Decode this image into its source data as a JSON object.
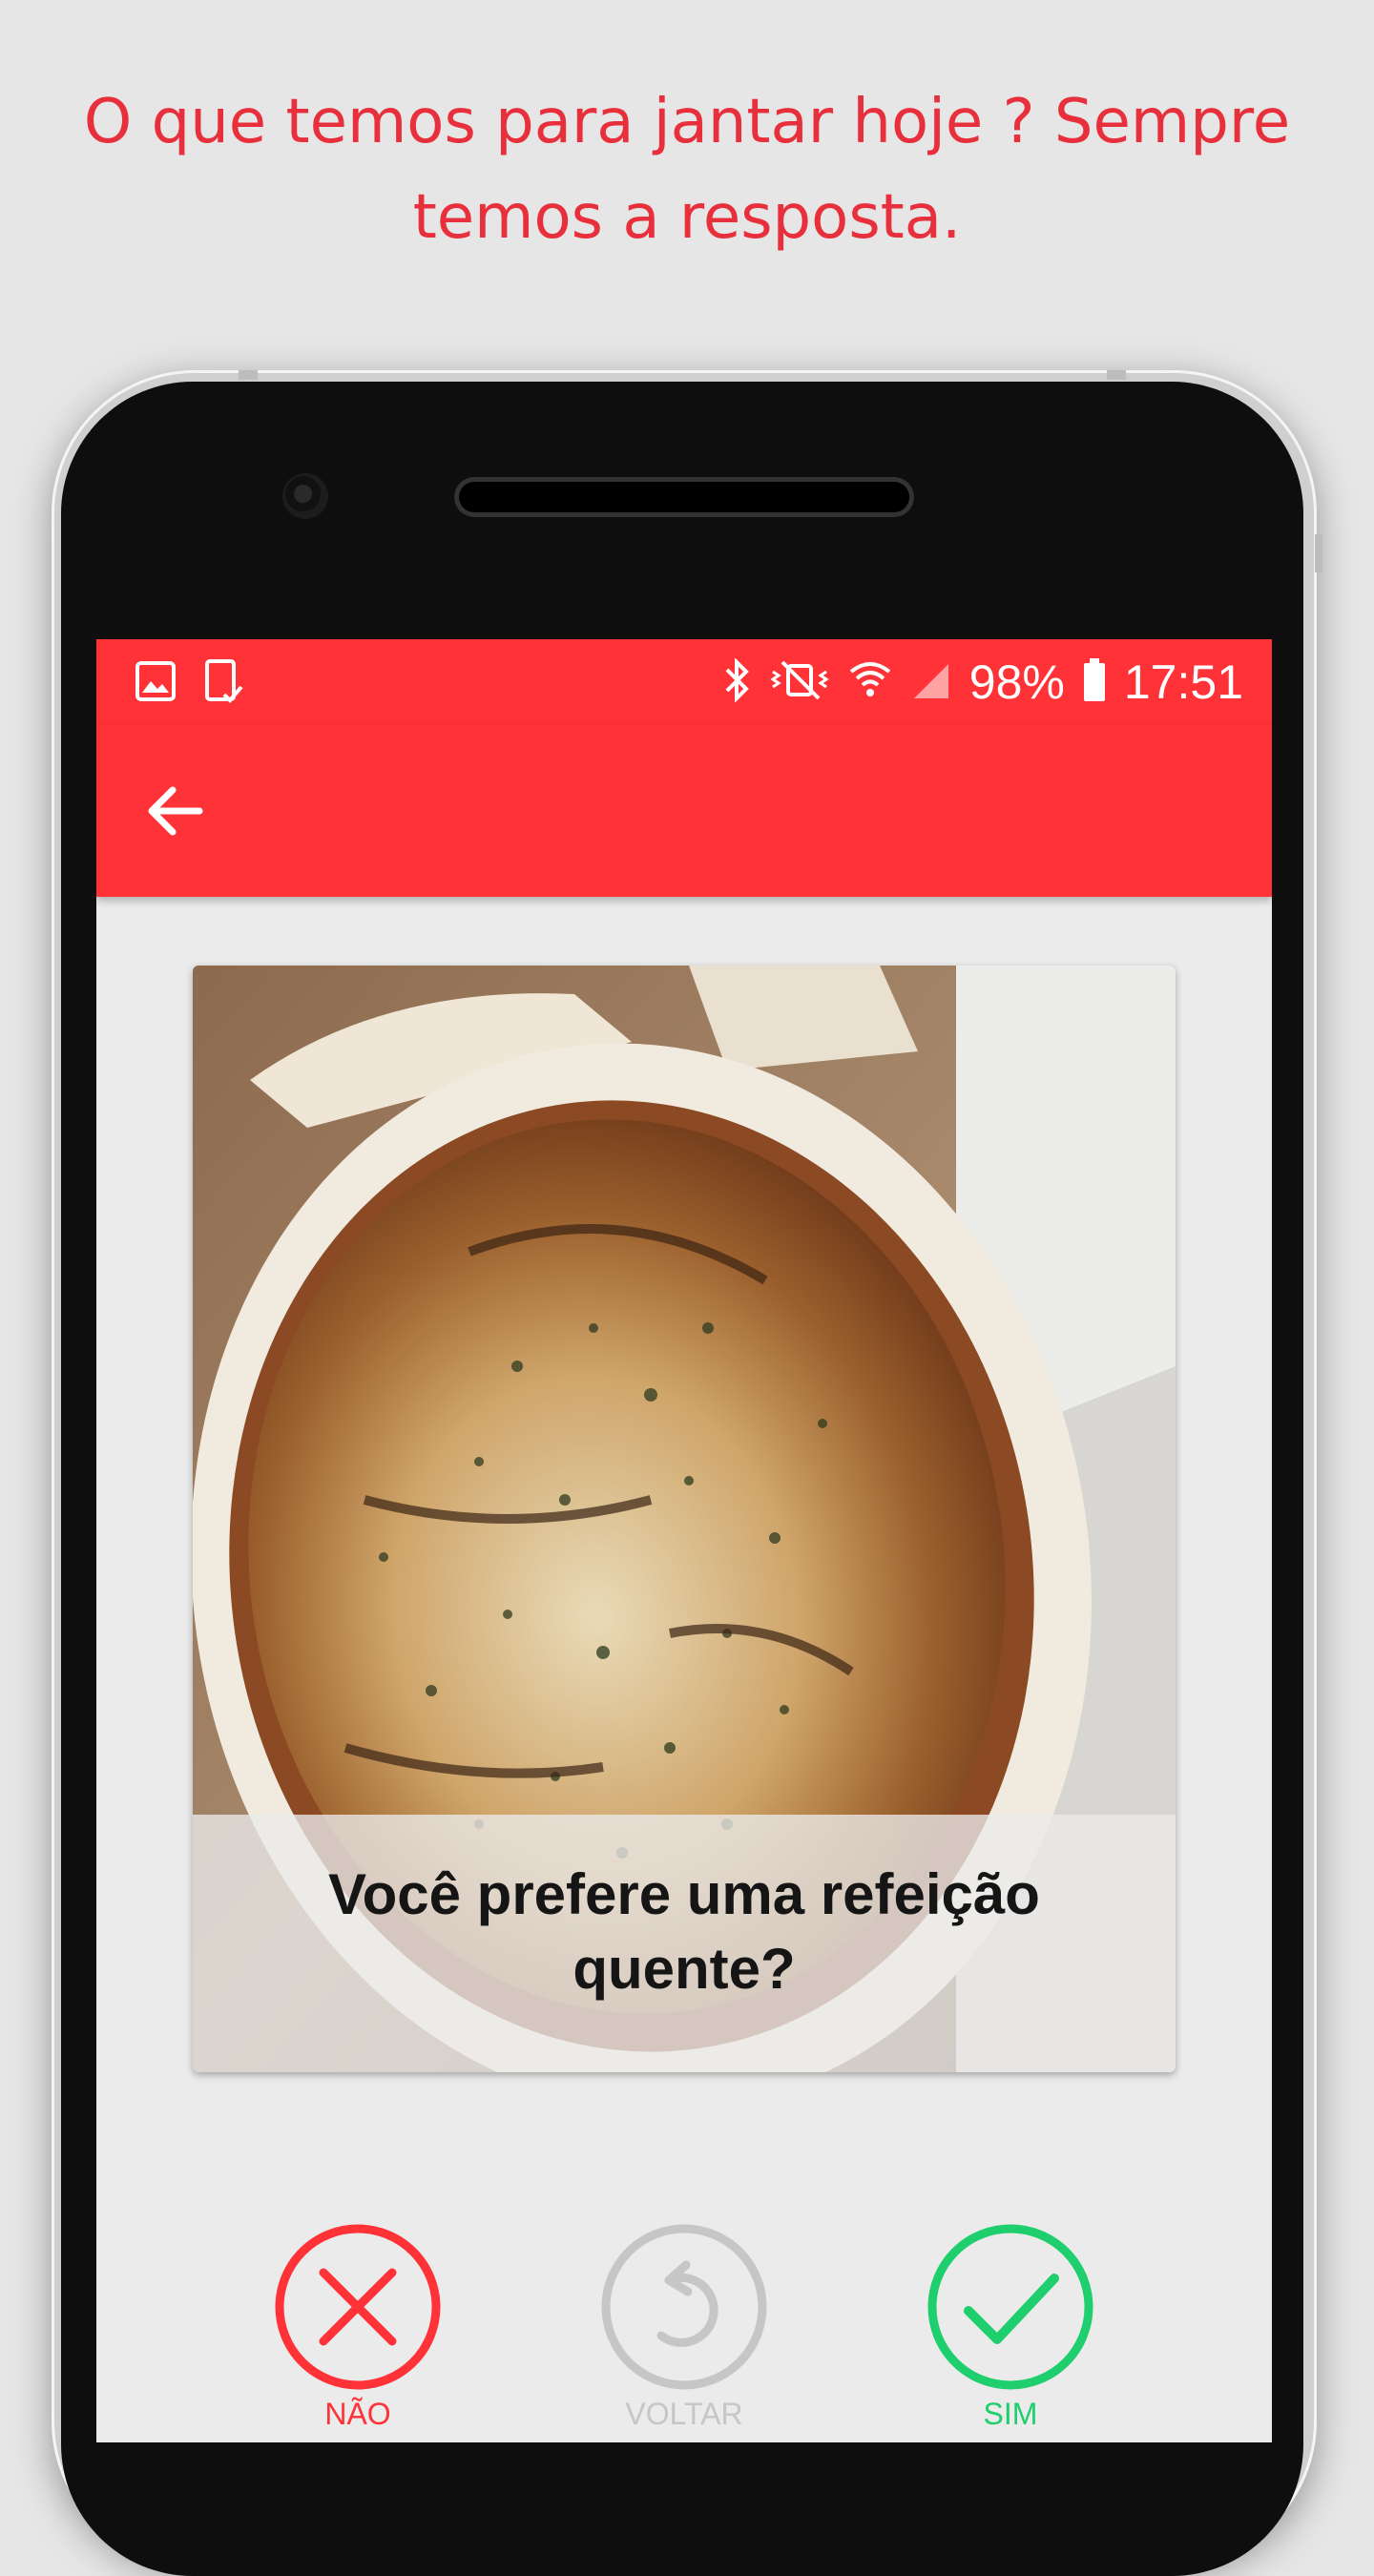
{
  "headline": "O que temos para jantar hoje ? Sempre temos a resposta.",
  "status_bar": {
    "battery": "98%",
    "time": "17:51",
    "icons": [
      "image-icon",
      "tablet-check-icon",
      "bluetooth-icon",
      "vibrate-off-icon",
      "wifi-icon",
      "signal-icon",
      "battery-icon"
    ]
  },
  "app_bar": {
    "back_icon": "arrow-left-icon"
  },
  "card": {
    "image": "eggplant-parmesan-photo",
    "question": "Você prefere uma refeição quente?"
  },
  "actions": {
    "no": {
      "label": "NÃO",
      "icon": "x-icon",
      "color": "#ff3237"
    },
    "back": {
      "label": "VOLTAR",
      "icon": "undo-icon",
      "color": "#c6c6c6"
    },
    "yes": {
      "label": "SIM",
      "icon": "check-icon",
      "color": "#1fce6d"
    }
  },
  "colors": {
    "accent": "#ff3237",
    "headline": "#e8303c"
  }
}
